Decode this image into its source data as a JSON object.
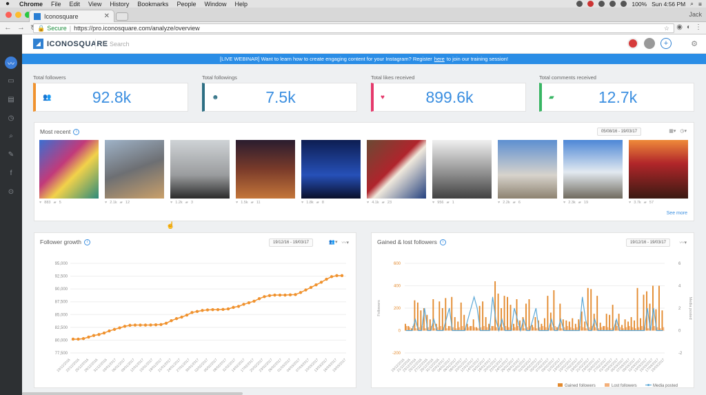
{
  "os_menubar": {
    "app": "Chrome",
    "menus": [
      "File",
      "Edit",
      "View",
      "History",
      "Bookmarks",
      "People",
      "Window",
      "Help"
    ],
    "battery": "100%",
    "clock": "Sun 4:56 PM"
  },
  "browser": {
    "tab_title": "Iconosquare",
    "tab_close": "✕",
    "profile_label": "Jack",
    "secure_label": "Secure",
    "url": "https://pro.iconosquare.com/analyze/overview"
  },
  "app": {
    "logo_text": "ICONOSQUARE",
    "search_placeholder": "Search",
    "banner": {
      "prefix": "[LIVE WEBINAR] Want to learn how to create engaging content for your Instagram? Register",
      "link": "here",
      "suffix": "to join our training session!"
    }
  },
  "stats": [
    {
      "label": "Total followers",
      "value": "92.8k",
      "color": "#f0922e",
      "icon": "people-icon"
    },
    {
      "label": "Total followings",
      "value": "7.5k",
      "color": "#2c6e83",
      "icon": "person-follow-icon"
    },
    {
      "label": "Total likes received",
      "value": "899.6k",
      "color": "#e5396b",
      "icon": "heart-icon"
    },
    {
      "label": "Total comments received",
      "value": "12.7k",
      "color": "#38b563",
      "icon": "comment-icon"
    }
  ],
  "most_recent": {
    "title": "Most recent",
    "date_range": "05/08/16 - 19/03/17",
    "see_more": "See more",
    "posts": [
      {
        "likes": "883",
        "comments": "5"
      },
      {
        "likes": "2.1k",
        "comments": "12"
      },
      {
        "likes": "1.2k",
        "comments": "3"
      },
      {
        "likes": "1.5k",
        "comments": "11"
      },
      {
        "likes": "1.8k",
        "comments": "8"
      },
      {
        "likes": "4.1k",
        "comments": "23"
      },
      {
        "likes": "956",
        "comments": "1"
      },
      {
        "likes": "2.2k",
        "comments": "6"
      },
      {
        "likes": "2.3k",
        "comments": "19"
      },
      {
        "likes": "3.7k",
        "comments": "57"
      }
    ]
  },
  "follower_growth": {
    "title": "Follower growth",
    "date_range": "19/12/16 - 19/03/17"
  },
  "gained_lost": {
    "title": "Gained & lost followers",
    "date_range": "19/12/16 - 19/03/17",
    "legend": [
      "Gained followers",
      "Lost followers",
      "Media posted"
    ]
  },
  "chart_data": [
    {
      "type": "line",
      "title": "Follower growth",
      "x_tick_labels": [
        "19/12/2016",
        "22/12/2016",
        "25/12/2016",
        "28/12/2016",
        "31/12/2016",
        "03/01/2017",
        "06/01/2017",
        "09/01/2017",
        "12/01/2017",
        "15/01/2017",
        "18/01/2017",
        "21/01/2017",
        "24/01/2017",
        "27/01/2017",
        "30/01/2017",
        "02/02/2017",
        "05/02/2017",
        "08/02/2017",
        "11/02/2017",
        "14/02/2017",
        "17/02/2017",
        "20/02/2017",
        "23/02/2017",
        "26/02/2017",
        "01/03/2017",
        "04/03/2017",
        "07/03/2017",
        "10/03/2017",
        "13/03/2017",
        "16/03/2017",
        "19/03/2017"
      ],
      "y_ticks": [
        77500,
        80000,
        82500,
        85000,
        87500,
        90000,
        92500,
        95000
      ],
      "ylim": [
        77500,
        95000
      ],
      "color": "#f0922e",
      "values": [
        80200,
        80200,
        80300,
        80600,
        80900,
        81100,
        81400,
        81800,
        82100,
        82400,
        82700,
        82900,
        82950,
        82950,
        82950,
        82960,
        83000,
        83050,
        83300,
        83800,
        84200,
        84500,
        84900,
        85400,
        85600,
        85800,
        85900,
        85950,
        85960,
        86000,
        86100,
        86400,
        86600,
        87000,
        87300,
        87600,
        88100,
        88500,
        88700,
        88800,
        88800,
        88800,
        88850,
        88900,
        89300,
        89800,
        90300,
        90800,
        91300,
        91900,
        92400,
        92600,
        92600
      ]
    },
    {
      "type": "bar",
      "title": "Gained & lost followers",
      "x_tick_labels": [
        "19/12/2016",
        "21/12/2016",
        "23/12/2016",
        "25/12/2016",
        "27/12/2016",
        "29/12/2016",
        "31/12/2016",
        "02/01/2017",
        "04/01/2017",
        "06/01/2017",
        "08/01/2017",
        "10/01/2017",
        "12/01/2017",
        "14/01/2017",
        "16/01/2017",
        "18/01/2017",
        "20/01/2017",
        "22/01/2017",
        "24/01/2017",
        "26/01/2017",
        "28/01/2017",
        "30/01/2017",
        "01/02/2017",
        "03/02/2017",
        "05/02/2017",
        "07/02/2017",
        "09/02/2017",
        "11/02/2017",
        "13/02/2017",
        "15/02/2017",
        "17/02/2017",
        "19/02/2017",
        "21/02/2017",
        "23/02/2017",
        "25/02/2017",
        "27/02/2017",
        "01/03/2017",
        "03/03/2017",
        "05/03/2017",
        "07/03/2017",
        "09/03/2017",
        "11/03/2017",
        "13/03/2017",
        "15/03/2017",
        "17/03/2017",
        "19/03/2017"
      ],
      "y_left_ticks": [
        -200,
        0,
        200,
        400,
        600
      ],
      "y_left_label": "Followers",
      "y_right_ticks": [
        -2,
        0,
        2,
        4,
        6
      ],
      "y_right_label": "Media posted",
      "ylim_left": [
        -200,
        600
      ],
      "ylim_right": [
        -2,
        6
      ],
      "series": [
        {
          "name": "Gained followers",
          "color": "#e38a2e",
          "values": [
            60,
            40,
            20,
            270,
            250,
            180,
            200,
            140,
            100,
            280,
            60,
            260,
            200,
            290,
            40,
            300,
            120,
            80,
            250,
            140,
            60,
            40,
            100,
            30,
            220,
            260,
            120,
            60,
            40,
            440,
            330,
            200,
            310,
            300,
            230,
            60,
            280,
            90,
            120,
            240,
            280,
            50,
            120,
            90,
            60,
            110,
            310,
            160,
            360,
            30,
            240,
            100,
            90,
            80,
            110,
            60,
            100,
            170,
            80,
            380,
            370,
            150,
            310,
            70,
            40,
            150,
            140,
            230,
            90,
            150,
            50,
            100,
            80,
            120,
            90,
            380,
            110,
            320,
            350,
            240,
            400,
            190,
            400,
            180
          ]
        },
        {
          "name": "Lost followers",
          "color": "#f3b07a",
          "values": [
            40,
            30,
            40,
            20,
            30,
            40,
            20,
            30,
            40,
            20,
            30,
            40,
            30,
            20,
            40,
            30,
            20,
            30,
            40,
            20,
            30,
            40,
            30,
            20,
            30,
            40,
            30,
            20,
            40,
            30,
            20,
            30,
            40,
            30,
            20,
            30,
            40,
            30,
            20,
            30,
            40,
            30,
            20,
            30,
            40,
            30,
            20,
            30,
            40,
            30,
            20,
            30,
            40,
            30,
            20,
            30,
            40,
            30,
            20,
            30,
            40,
            30,
            20,
            30,
            40,
            30,
            20,
            30,
            40,
            30,
            20,
            30,
            40,
            30,
            20,
            30,
            40,
            30,
            20,
            30,
            40,
            30,
            20,
            30
          ]
        },
        {
          "name": "Media posted",
          "color": "#5aa7d6",
          "values": [
            0,
            0,
            0,
            1,
            0,
            0,
            2,
            0,
            0,
            1,
            0,
            0,
            0,
            1,
            2,
            0,
            0,
            0,
            0,
            0,
            1,
            2,
            3,
            2,
            0,
            0,
            0,
            0,
            3,
            1,
            0,
            1,
            0,
            0,
            0,
            2,
            1,
            0,
            1,
            0,
            0,
            1,
            2,
            0,
            0,
            0,
            0,
            1,
            0,
            0,
            1,
            0,
            0,
            0,
            0,
            0,
            0,
            3,
            1,
            0,
            0,
            1,
            0,
            0,
            0,
            0,
            0,
            0,
            1,
            0,
            0,
            0,
            0,
            0,
            0,
            0,
            0,
            0,
            2,
            0,
            2,
            0,
            0,
            0
          ]
        }
      ]
    }
  ]
}
